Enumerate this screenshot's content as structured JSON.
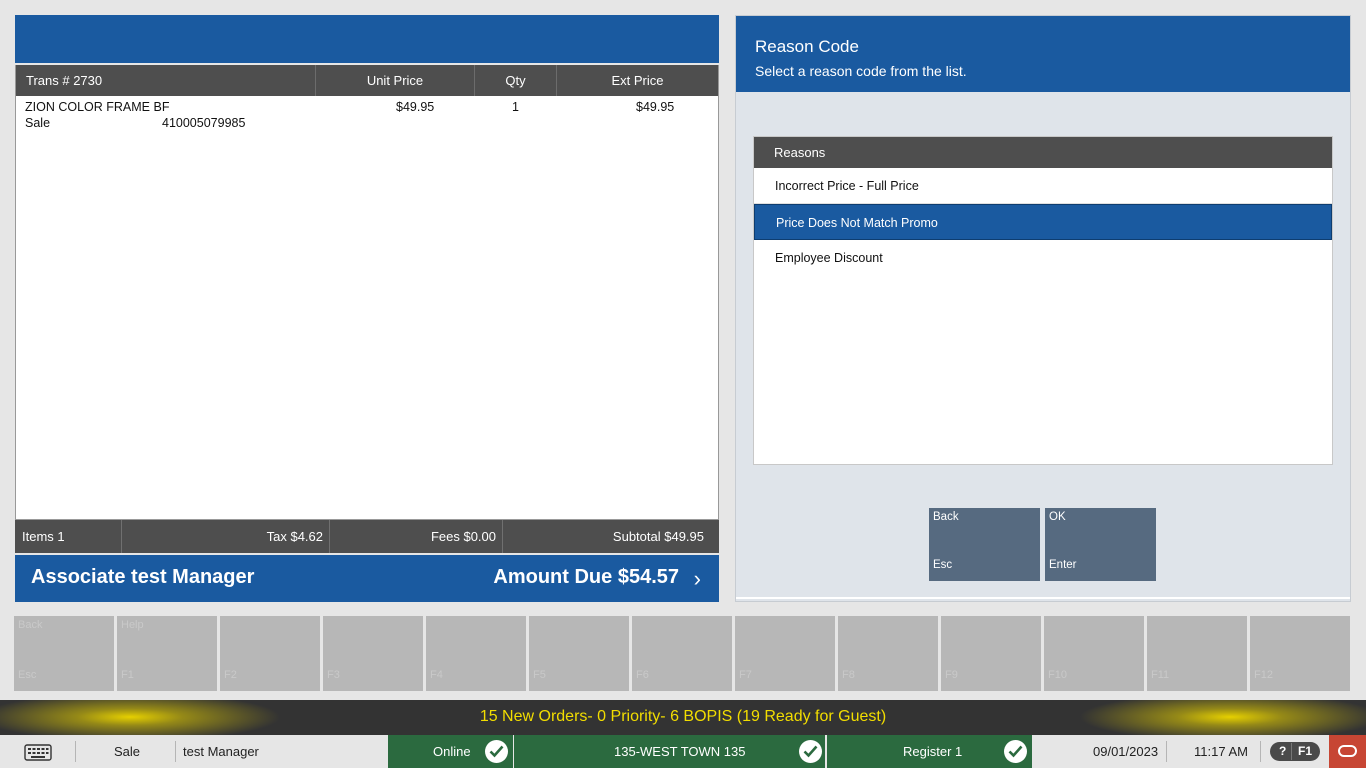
{
  "transaction": {
    "columns": {
      "trans": "Trans #  2730",
      "unit_price": "Unit Price",
      "qty": "Qty",
      "ext_price": "Ext Price"
    },
    "items": [
      {
        "name": "ZION COLOR FRAME BF",
        "type": "Sale",
        "sku": "410005079985",
        "unit_price": "$49.95",
        "qty": "1",
        "ext_price": "$49.95"
      }
    ],
    "totals": {
      "items": "Items 1",
      "tax": "Tax $4.62",
      "fees": "Fees $0.00",
      "subtotal": "Subtotal $49.95"
    },
    "associate": "Associate test Manager",
    "amount_due": "Amount Due  $54.57",
    "amount_chevron": "›"
  },
  "reason_code": {
    "title": "Reason Code",
    "subtitle": "Select a reason code from the list.",
    "list_header": "Reasons",
    "reasons": [
      {
        "label": "Incorrect Price - Full Price",
        "selected": false
      },
      {
        "label": "Price Does Not Match Promo",
        "selected": true
      },
      {
        "label": "Employee Discount",
        "selected": false
      }
    ],
    "buttons": {
      "back": {
        "label": "Back",
        "key": "Esc"
      },
      "ok": {
        "label": "OK",
        "key": "Enter"
      }
    }
  },
  "function_keys": [
    {
      "label": "Back",
      "key": "Esc"
    },
    {
      "label": "Help",
      "key": "F1"
    },
    {
      "label": "",
      "key": "F2"
    },
    {
      "label": "",
      "key": "F3"
    },
    {
      "label": "",
      "key": "F4"
    },
    {
      "label": "",
      "key": "F5"
    },
    {
      "label": "",
      "key": "F6"
    },
    {
      "label": "",
      "key": "F7"
    },
    {
      "label": "",
      "key": "F8"
    },
    {
      "label": "",
      "key": "F9"
    },
    {
      "label": "",
      "key": "F10"
    },
    {
      "label": "",
      "key": "F11"
    },
    {
      "label": "",
      "key": "F12"
    }
  ],
  "notification": "15 New Orders- 0 Priority- 6 BOPIS (19 Ready for Guest)",
  "status_bar": {
    "mode": "Sale",
    "user": "test Manager",
    "online": "Online",
    "store": "135-WEST TOWN 135",
    "register": "Register 1",
    "date": "09/01/2023",
    "time": "11:17 AM",
    "help_q": "?",
    "help_key": "F1"
  },
  "colors": {
    "brand_blue": "#1a5aa0",
    "status_green": "#2b6a3f",
    "notify_yellow": "#f2dd00",
    "oracle_red": "#c74634"
  },
  "icons": [
    "keyboard-icon",
    "check-icon",
    "chevron-right-icon",
    "oracle-logo-icon"
  ]
}
